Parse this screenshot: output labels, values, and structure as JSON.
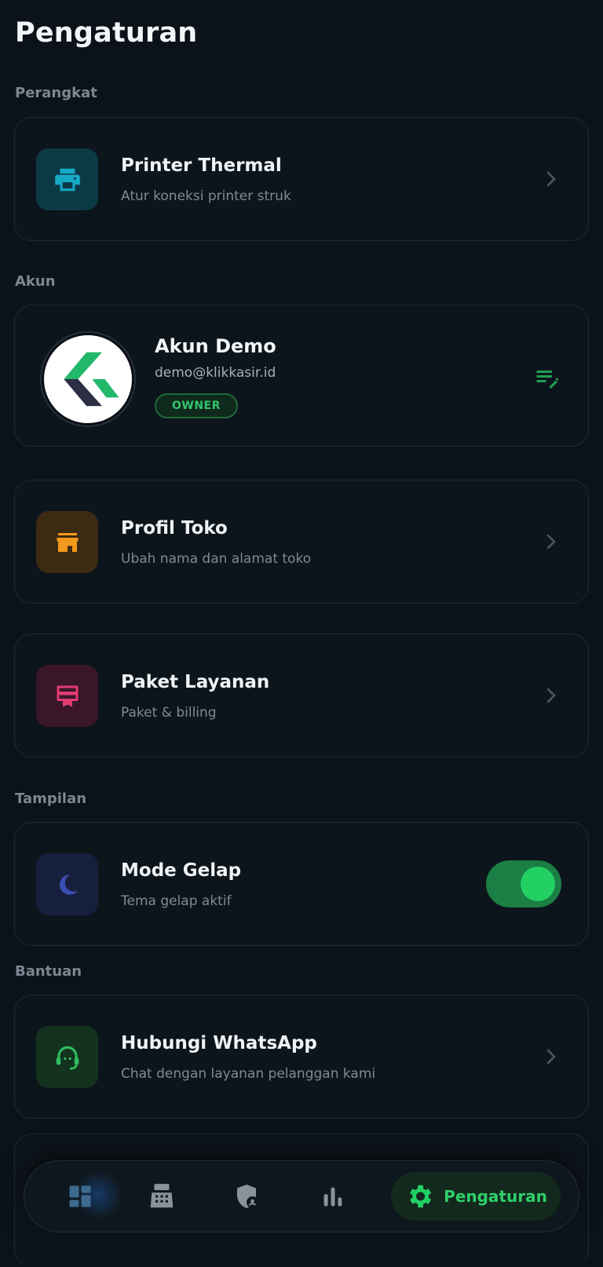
{
  "page": {
    "title": "Pengaturan"
  },
  "sections": {
    "perangkat": "Perangkat",
    "akun": "Akun",
    "tampilan": "Tampilan",
    "bantuan": "Bantuan"
  },
  "items": {
    "printer": {
      "title": "Printer Thermal",
      "subtitle": "Atur koneksi printer struk",
      "icon": "printer-icon",
      "color": "#16a9c4"
    },
    "profil_toko": {
      "title": "Profil Toko",
      "subtitle": "Ubah nama dan alamat toko",
      "icon": "store-icon",
      "color": "#f29a1c"
    },
    "paket": {
      "title": "Paket Layanan",
      "subtitle": "Paket & billing",
      "icon": "card-membership-icon",
      "color": "#e23b72"
    },
    "mode_gelap": {
      "title": "Mode Gelap",
      "subtitle": "Tema gelap aktif",
      "icon": "moon-icon",
      "color": "#3d4fb3",
      "enabled": true
    },
    "whatsapp": {
      "title": "Hubungi WhatsApp",
      "subtitle": "Chat dengan layanan pelanggan kami",
      "icon": "support-agent-icon",
      "color": "#2ebd5e"
    }
  },
  "account": {
    "name": "Akun Demo",
    "email": "demo@klikkasir.id",
    "role": "OWNER"
  },
  "nav": {
    "items": [
      "dashboard-icon",
      "cash-register-icon",
      "admin-shield-icon",
      "bar-chart-icon",
      "settings-icon"
    ],
    "active_label": "Pengaturan"
  },
  "colors": {
    "accent": "#22d064",
    "background": "#0b1219"
  }
}
